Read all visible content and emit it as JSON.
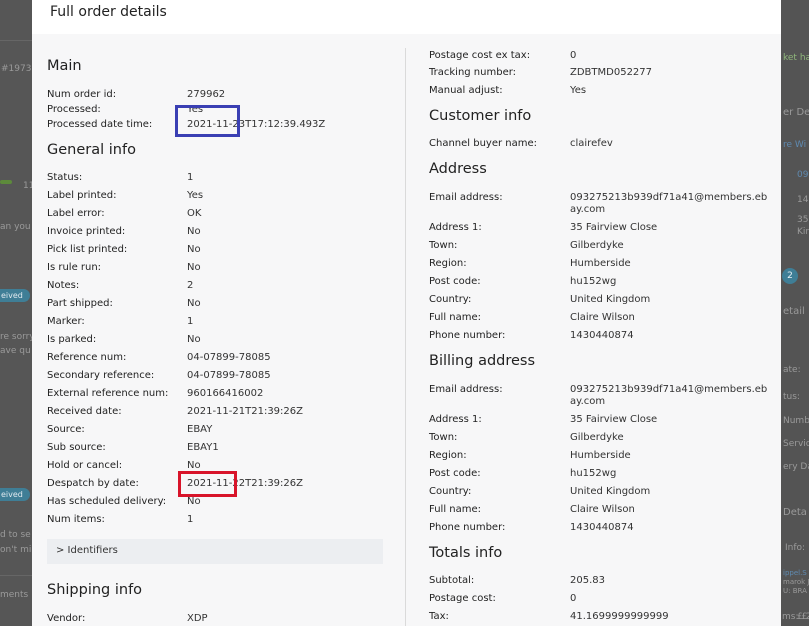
{
  "title": "Full order details",
  "background": {
    "fragments": [
      "#1973",
      "11",
      "an you",
      "re sorry",
      "ave qu",
      "d to se",
      "on't mi",
      "ments",
      "ket ha",
      "er De",
      "re Wi",
      "09",
      "14",
      "35",
      "Kin",
      "etail",
      "ate:",
      "tus:",
      "Numbe",
      "Service",
      "ery Da",
      "Deta",
      "Info:",
      "ippel.S",
      "marok J",
      "U: BRA",
      "ms: £",
      "£ 2"
    ],
    "badges": [
      "eived",
      "eived"
    ],
    "circle": "2"
  },
  "main": {
    "title": "Main",
    "rows": [
      {
        "label": "Num order id:",
        "value": "279962"
      },
      {
        "label": "Processed:",
        "value": "Yes"
      },
      {
        "label": "Processed date time:",
        "value": "2021-11-23T17:12:39.493Z"
      }
    ]
  },
  "general": {
    "title": "General info",
    "rows": [
      {
        "label": "Status:",
        "value": "1"
      },
      {
        "label": "Label printed:",
        "value": "Yes"
      },
      {
        "label": "Label error:",
        "value": "OK"
      },
      {
        "label": "Invoice printed:",
        "value": "No"
      },
      {
        "label": "Pick list printed:",
        "value": "No"
      },
      {
        "label": "Is rule run:",
        "value": "No"
      },
      {
        "label": "Notes:",
        "value": "2"
      },
      {
        "label": "Part shipped:",
        "value": "No"
      },
      {
        "label": "Marker:",
        "value": "1"
      },
      {
        "label": "Is parked:",
        "value": "No"
      },
      {
        "label": "Reference num:",
        "value": "04-07899-78085"
      },
      {
        "label": "Secondary reference:",
        "value": "04-07899-78085"
      },
      {
        "label": "External reference num:",
        "value": "960166416002"
      },
      {
        "label": "Received date:",
        "value": "2021-11-21T21:39:26Z"
      },
      {
        "label": "Source:",
        "value": "EBAY"
      },
      {
        "label": "Sub source:",
        "value": "EBAY1"
      },
      {
        "label": "Hold or cancel:",
        "value": "No"
      },
      {
        "label": "Despatch by date:",
        "value": "2021-11-22T21:39:26Z"
      },
      {
        "label": "Has scheduled delivery:",
        "value": "No"
      },
      {
        "label": "Num items:",
        "value": "1"
      }
    ]
  },
  "identifiers": {
    "label": "> Identifiers"
  },
  "shipping": {
    "title": "Shipping info",
    "rows": [
      {
        "label": "Vendor:",
        "value": "XDP"
      }
    ]
  },
  "shipping_cont": {
    "rows": [
      {
        "label": "Postage cost ex tax:",
        "value": "0"
      },
      {
        "label": "Tracking number:",
        "value": "ZDBTMD052277"
      },
      {
        "label": "Manual adjust:",
        "value": "Yes"
      }
    ]
  },
  "customer": {
    "title": "Customer info",
    "rows": [
      {
        "label": "Channel buyer name:",
        "value": "clairefev"
      }
    ]
  },
  "address": {
    "title": "Address",
    "rows": [
      {
        "label": "Email address:",
        "value": "093275213b939df71a41@members.ebay.com"
      },
      {
        "label": "Address 1:",
        "value": "35 Fairview Close"
      },
      {
        "label": "Town:",
        "value": "Gilberdyke"
      },
      {
        "label": "Region:",
        "value": "Humberside"
      },
      {
        "label": "Post code:",
        "value": "hu152wg"
      },
      {
        "label": "Country:",
        "value": "United Kingdom"
      },
      {
        "label": "Full name:",
        "value": "Claire Wilson"
      },
      {
        "label": "Phone number:",
        "value": "1430440874"
      }
    ]
  },
  "billing": {
    "title": "Billing address",
    "rows": [
      {
        "label": "Email address:",
        "value": "093275213b939df71a41@members.ebay.com"
      },
      {
        "label": "Address 1:",
        "value": "35 Fairview Close"
      },
      {
        "label": "Town:",
        "value": "Gilberdyke"
      },
      {
        "label": "Region:",
        "value": "Humberside"
      },
      {
        "label": "Post code:",
        "value": "hu152wg"
      },
      {
        "label": "Country:",
        "value": "United Kingdom"
      },
      {
        "label": "Full name:",
        "value": "Claire Wilson"
      },
      {
        "label": "Phone number:",
        "value": "1430440874"
      }
    ]
  },
  "totals": {
    "title": "Totals info",
    "rows": [
      {
        "label": "Subtotal:",
        "value": "205.83"
      },
      {
        "label": "Postage cost:",
        "value": "0"
      },
      {
        "label": "Tax:",
        "value": "41.1699999999999"
      }
    ]
  },
  "colors": {
    "highlight_blue": "#3a3fb3",
    "highlight_red": "#d8142a",
    "overlay": "#4f4f4f"
  }
}
